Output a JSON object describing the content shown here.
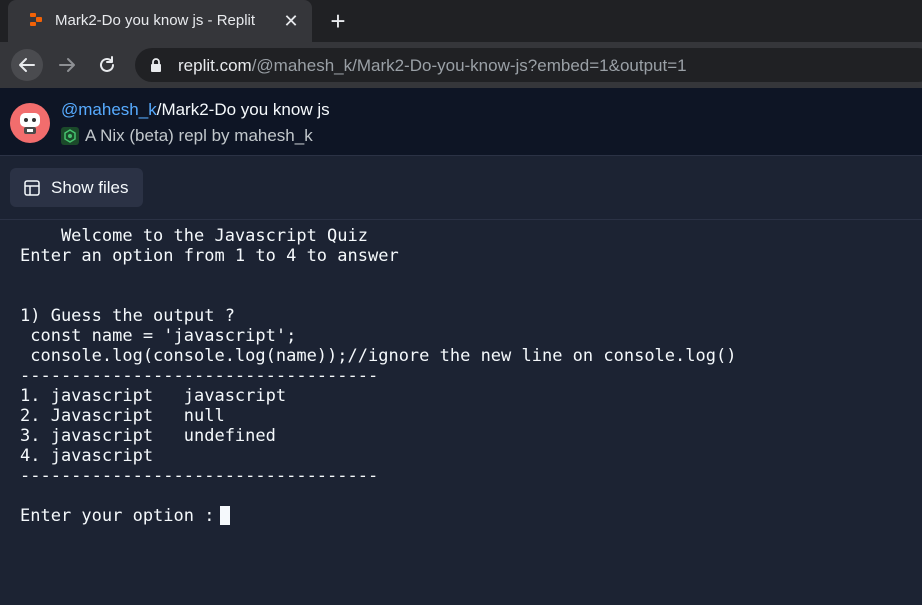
{
  "browser": {
    "tab_title": "Mark2-Do you know js - Replit",
    "close_glyph": "✕",
    "new_tab_glyph": "+",
    "url_host": "replit.com",
    "url_path": "/@mahesh_k/Mark2-Do-you-know-js?embed=1&output=1"
  },
  "repl": {
    "owner": "@mahesh_k",
    "separator": "/",
    "name": "Mark2-Do you know js",
    "subtitle": "A Nix (beta) repl by mahesh_k"
  },
  "files_button": {
    "label": "Show files"
  },
  "console": {
    "lines": [
      "    Welcome to the Javascript Quiz",
      "Enter an option from 1 to 4 to answer",
      "",
      "",
      "1) Guess the output ?",
      " const name = 'javascript';",
      " console.log(console.log(name));//ignore the new line on console.log()",
      "-----------------------------------",
      "1. javascript   javascript",
      "2. Javascript   null",
      "3. javascript   undefined",
      "4. javascript",
      "-----------------------------------",
      "",
      "Enter your option : "
    ]
  },
  "colors": {
    "background": "#1c2333",
    "header": "#0e1525",
    "owner_link": "#57abff",
    "favicon": "#f26207"
  },
  "icons": {
    "favicon": "replit-logo-icon",
    "back": "arrow-left-icon",
    "forward": "arrow-right-icon",
    "reload": "reload-icon",
    "lock": "lock-icon",
    "nix": "nix-icon",
    "files": "files-icon"
  }
}
